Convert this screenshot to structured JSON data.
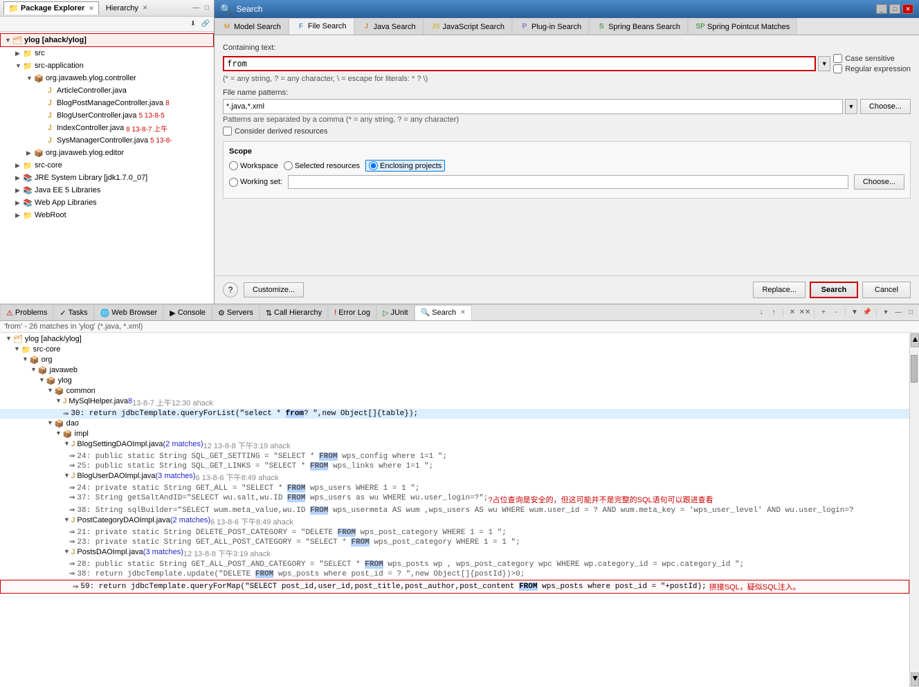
{
  "packageExplorer": {
    "title": "Package Explorer",
    "tabs": [
      "Package Explorer",
      "Hierarchy"
    ],
    "tree": [
      {
        "id": "ylog",
        "label": "ylog [ahack/ylog]",
        "indent": 0,
        "arrow": "▼",
        "icon": "project",
        "highlighted": true
      },
      {
        "id": "src",
        "label": "src",
        "indent": 1,
        "arrow": "▶",
        "icon": "folder-src"
      },
      {
        "id": "src-application",
        "label": "src-application",
        "indent": 1,
        "arrow": "▼",
        "icon": "folder-src"
      },
      {
        "id": "controller",
        "label": "org.javaweb.ylog.controller",
        "indent": 2,
        "arrow": "▼",
        "icon": "package"
      },
      {
        "id": "ArticleController",
        "label": "ArticleController.java",
        "indent": 3,
        "arrow": "",
        "icon": "java"
      },
      {
        "id": "BlogPostManageController",
        "label": "BlogPostManageController.java",
        "indent": 3,
        "arrow": "",
        "icon": "java",
        "badge": "8",
        "badgeColor": "red"
      },
      {
        "id": "BlogUserController",
        "label": "BlogUserController.java",
        "indent": 3,
        "arrow": "",
        "icon": "java",
        "badge": "5 13-8-5",
        "badgeColor": "red"
      },
      {
        "id": "IndexController",
        "label": "IndexController.java",
        "indent": 3,
        "arrow": "",
        "icon": "java",
        "badge": "8 13-8-7 上午",
        "badgeColor": "red"
      },
      {
        "id": "SysManagerController",
        "label": "SysManagerController.java",
        "indent": 3,
        "arrow": "",
        "icon": "java",
        "badge": "5 13-8-",
        "badgeColor": "red"
      },
      {
        "id": "editor",
        "label": "org.javaweb.ylog.editor",
        "indent": 2,
        "arrow": "▶",
        "icon": "package"
      },
      {
        "id": "src-core",
        "label": "src-core",
        "indent": 1,
        "arrow": "▶",
        "icon": "folder-src"
      },
      {
        "id": "jre",
        "label": "JRE System Library [jdk1.7.0_07]",
        "indent": 1,
        "arrow": "▶",
        "icon": "lib"
      },
      {
        "id": "javaee",
        "label": "Java EE 5 Libraries",
        "indent": 1,
        "arrow": "▶",
        "icon": "lib"
      },
      {
        "id": "webapp",
        "label": "Web App Libraries",
        "indent": 1,
        "arrow": "▶",
        "icon": "lib"
      },
      {
        "id": "webroot",
        "label": "WebRoot",
        "indent": 1,
        "arrow": "▶",
        "icon": "folder-src"
      }
    ]
  },
  "searchDialog": {
    "title": "Search",
    "tabs": [
      {
        "id": "model",
        "label": "Model Search",
        "icon": "M"
      },
      {
        "id": "file",
        "label": "File Search",
        "icon": "F",
        "active": true
      },
      {
        "id": "java",
        "label": "Java Search",
        "icon": "J"
      },
      {
        "id": "javascript",
        "label": "JavaScript Search",
        "icon": "JS"
      },
      {
        "id": "plugin",
        "label": "Plug-in Search",
        "icon": "P"
      },
      {
        "id": "spring",
        "label": "Spring Beans Search",
        "icon": "S"
      },
      {
        "id": "pointcut",
        "label": "Spring Pointcut Matches",
        "icon": "SP"
      }
    ],
    "form": {
      "containingTextLabel": "Containing text:",
      "containingTextValue": "from",
      "hint": "(* = any string, ? = any character, \\ = escape for literals: * ? \\)",
      "caseSensitiveLabel": "Case sensitive",
      "regularExpressionLabel": "Regular expression",
      "fileNamePatternsLabel": "File name patterns:",
      "fileNamePatternsValue": "*.java,*.xml",
      "fileNamePatternsHint": "Patterns are separated by a comma (* = any string, ? = any character)",
      "considerDerivedLabel": "Consider derived resources",
      "chooseBtnLabel": "Choose...",
      "scopeLabel": "Scope",
      "scopeOptions": [
        "Workspace",
        "Selected resources",
        "Enclosing projects",
        "Working set:"
      ],
      "selectedScope": "Enclosing projects",
      "workingSetValue": ""
    },
    "footer": {
      "customizeLabel": "Customize...",
      "replaceLabel": "Replace...",
      "searchLabel": "Search",
      "cancelLabel": "Cancel"
    }
  },
  "bottomPanel": {
    "tabs": [
      "Problems",
      "Tasks",
      "Web Browser",
      "Console",
      "Servers",
      "Call Hierarchy",
      "Error Log",
      "JUnit",
      "Search"
    ],
    "activeTab": "Search",
    "resultsHeader": "'from' - 26 matches in 'ylog' (*.java, *.xml)",
    "tree": [
      {
        "type": "root",
        "label": "ylog [ahack/ylog]",
        "indent": 0,
        "arrow": "▼",
        "icon": "project"
      },
      {
        "type": "folder",
        "label": "src-core",
        "indent": 1,
        "arrow": "▼",
        "icon": "folder"
      },
      {
        "type": "folder",
        "label": "org",
        "indent": 2,
        "arrow": "▼",
        "icon": "package"
      },
      {
        "type": "folder",
        "label": "javaweb",
        "indent": 3,
        "arrow": "▼",
        "icon": "package"
      },
      {
        "type": "folder",
        "label": "ylog",
        "indent": 4,
        "arrow": "▼",
        "icon": "package"
      },
      {
        "type": "folder",
        "label": "common",
        "indent": 5,
        "arrow": "▼",
        "icon": "package"
      },
      {
        "type": "file",
        "label": "MySqlHelper.java",
        "indent": 6,
        "arrow": "▼",
        "icon": "java",
        "matches": "8",
        "meta": "13-8-7 上午12:30  ahack"
      },
      {
        "type": "match",
        "indent": 7,
        "lineNum": "30:",
        "text": "return jdbcTemplate.queryForList(\"select * ",
        "highlight": "from",
        "text2": "? \",new Object[]{table});",
        "highlighted": true
      },
      {
        "type": "folder",
        "label": "dao",
        "indent": 5,
        "arrow": "▼",
        "icon": "package"
      },
      {
        "type": "folder",
        "label": "impl",
        "indent": 6,
        "arrow": "▼",
        "icon": "package"
      },
      {
        "type": "file",
        "label": "BlogSettingDAOImpl.java",
        "indent": 7,
        "arrow": "▼",
        "icon": "java",
        "matches": "2 matches",
        "meta": "12 13-8-8 下午3:19  ahack"
      },
      {
        "type": "match",
        "indent": 8,
        "lineNum": "24:",
        "text": "public static String SQL_GET_SETTING = \"SELECT * ",
        "highlight": "FROM",
        "text2": " wps_config where 1=1 \";"
      },
      {
        "type": "match",
        "indent": 8,
        "lineNum": "25:",
        "text": "public static String SQL_GET_LINKS = \"SELECT * ",
        "highlight": "FROM",
        "text2": " wps_links where 1=1 \";"
      },
      {
        "type": "file",
        "label": "BlogUserDAOImpl.java",
        "indent": 7,
        "arrow": "▼",
        "icon": "java",
        "matches": "3 matches",
        "meta": "6 13-8-6 下午8:49  ahack"
      },
      {
        "type": "match",
        "indent": 8,
        "lineNum": "24:",
        "text": "private static String GET_ALL = \"SELECT * ",
        "highlight": "FROM",
        "text2": " wps_users WHERE 1 = 1 \";"
      },
      {
        "type": "match",
        "indent": 8,
        "lineNum": "37:",
        "text": "String getSaltAndID=\"SELECT wu.salt,wu.ID ",
        "highlight": "FROM",
        "text2": " wps_users as wu WHERE wu.user_login=?\";",
        "chinese": " ?占位查询是安全的，但这可能并不是完整的SQL语句可以跟进查看"
      },
      {
        "type": "match",
        "indent": 8,
        "lineNum": "38:",
        "text": "String sqlBuilder=\"SELECT wum.meta_value,wu.ID ",
        "highlight": "FROM",
        "text2": " wps_usermeta AS wum ,wps_users AS wu WHERE wum.user_id = ? AND wum.meta_key = 'wps_user_level' AND wu.user_login=?"
      },
      {
        "type": "file",
        "label": "PostCategoryDAOImpl.java",
        "indent": 7,
        "arrow": "▼",
        "icon": "java",
        "matches": "2 matches",
        "meta": "6 13-8-6 下午8:49  ahack"
      },
      {
        "type": "match",
        "indent": 8,
        "lineNum": "21:",
        "text": "private static String DELETE_POST_CATEGORY = \"DELETE ",
        "highlight": "FROM",
        "text2": " wps_post_category WHERE 1 = 1 \";"
      },
      {
        "type": "match",
        "indent": 8,
        "lineNum": "23:",
        "text": "private static String GET_ALL_POST_CATEGORY = \"SELECT * ",
        "highlight": "FROM",
        "text2": " wps_post_category WHERE 1 = 1 \";"
      },
      {
        "type": "file",
        "label": "PostsDAOImpl.java",
        "indent": 7,
        "arrow": "▼",
        "icon": "java",
        "matches": "3 matches",
        "meta": "12 13-8-8 下午3:19  ahack"
      },
      {
        "type": "match",
        "indent": 8,
        "lineNum": "28:",
        "text": "public static String GET_ALL_POST_AND_CATEGORY = \"SELECT * ",
        "highlight": "FROM",
        "text2": " wps_posts wp , wps_post_category wpc WHERE wp.category_id = wpc.category_id \";"
      },
      {
        "type": "match",
        "indent": 8,
        "lineNum": "38:",
        "text": "return jdbcTemplate.update(\"DELETE ",
        "highlight": "FROM",
        "text2": " wps_posts where post_id = ? \",new Object[]{postId})>0;"
      },
      {
        "type": "match",
        "indent": 8,
        "lineNum": "59:",
        "text": "return jdbcTemplate.queryForMap(\"SELECT post_id,user_id,post_title,post_author,post_content ",
        "highlight": "FROM",
        "text2": " wps_posts where post_id = \"+postId);",
        "chinese2": "  拼接SQL，疑似SQL注入。",
        "highlightLine": true
      }
    ]
  },
  "icons": {
    "folder": "📁",
    "java": "☕",
    "package": "📦",
    "project": "🗂",
    "lib": "📚"
  }
}
